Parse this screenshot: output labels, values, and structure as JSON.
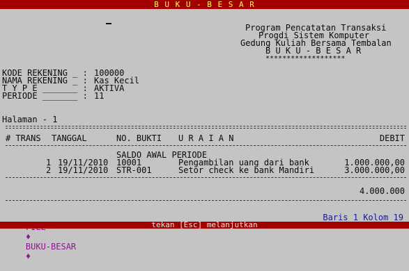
{
  "window": {
    "title": "B U K U - B E S A R"
  },
  "report_header": {
    "line1": "Program Pencatatan Transaksi",
    "line2": "Progdi Sistem Komputer",
    "line3": "Gedung Kuliah Bersama Tembalan",
    "line4": "B U K U - B E S A R",
    "line5": "*******************"
  },
  "account": {
    "kode_label": "KODE REKENING _ :",
    "kode_value": "100000",
    "nama_label": "NAMA REKENING _ :",
    "nama_value": "Kas Kecil",
    "type_label": "T Y P E _______ :",
    "type_value": "AKTIVA",
    "periode_label": "PERIODE _______ :",
    "periode_value": "11"
  },
  "page": {
    "label": "Halaman - 1"
  },
  "table": {
    "headers": {
      "trans": "# TRANS",
      "tanggal": "TANGGAL",
      "bukti": "NO. BUKTI",
      "uraian": "U R A I A N",
      "debit": "DEBIT"
    },
    "opening_label": "SALDO AWAL PERIODE",
    "rows": [
      {
        "trans": "1",
        "tanggal": "19/11/2010",
        "bukti": "10001",
        "uraian": "Pengambilan uang dari bank",
        "debit": "1.000.000,00"
      },
      {
        "trans": "2",
        "tanggal": "19/11/2010",
        "bukti": "STR-001",
        "uraian": "Setor check ke bank Mandiri",
        "debit": "3.000.000,00"
      }
    ],
    "total": "4.000.000"
  },
  "menu": {
    "file": "FILE",
    "separator": "♦",
    "buku_besar": "BUKU-BESAR"
  },
  "cursor_position": {
    "text": "Baris 1 Kolom 19"
  },
  "status": {
    "text": "tekan [Esc] melanjutkan"
  },
  "colors": {
    "title_bg": "#a30000",
    "title_fg": "#ffff55",
    "screen_bg": "#c4c4c4",
    "menu_fg": "#8b1a8b",
    "position_fg": "#1a1a8e"
  }
}
